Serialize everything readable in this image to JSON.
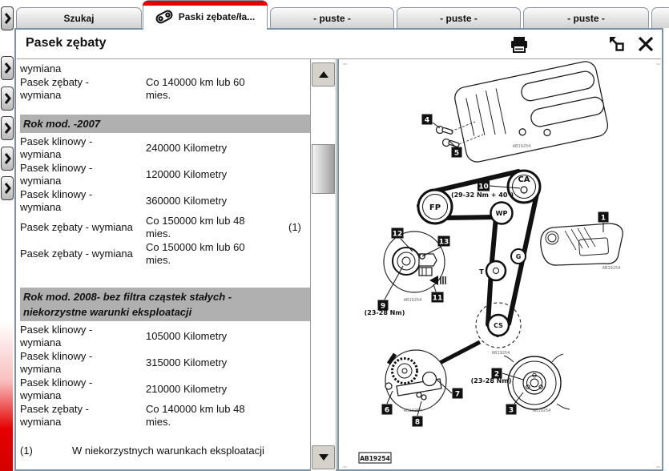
{
  "tabs": {
    "items": [
      {
        "label": "Szukaj"
      },
      {
        "label": "Paski zębate/ła..."
      },
      {
        "label": "- puste -"
      },
      {
        "label": "- puste -"
      },
      {
        "label": "- puste -"
      }
    ]
  },
  "panel": {
    "title": "Pasek zębaty"
  },
  "table": {
    "rows": [
      {
        "label": "wymiana",
        "value": "",
        "note": ""
      },
      {
        "label": "Pasek zębaty -\nwymiana",
        "value": "Co 140000 km lub 60\nmies.",
        "note": ""
      },
      {
        "label": "Pasek klinowy -\nwymiana",
        "value": "240000 Kilometry",
        "note": ""
      },
      {
        "label": "Pasek klinowy -\nwymiana",
        "value": "120000 Kilometry",
        "note": ""
      },
      {
        "label": "Pasek klinowy -\nwymiana",
        "value": "360000 Kilometry",
        "note": ""
      },
      {
        "label": "Pasek zębaty - wymiana",
        "value": "Co 150000 km lub 48\nmies.",
        "note": "(1)"
      },
      {
        "label": "Pasek zębaty - wymiana",
        "value": "Co 150000 km lub 60\nmies.",
        "note": ""
      },
      {
        "label": "Pasek klinowy -\nwymiana",
        "value": "105000 Kilometry",
        "note": ""
      },
      {
        "label": "Pasek klinowy -\nwymiana",
        "value": "315000 Kilometry",
        "note": ""
      },
      {
        "label": "Pasek klinowy -\nwymiana",
        "value": "210000 Kilometry",
        "note": ""
      },
      {
        "label": "Pasek zębaty -\nwymiana",
        "value": "Co 140000 km lub 48\nmies.",
        "note": ""
      }
    ],
    "sections": [
      {
        "title": "Rok mod. -2007"
      },
      {
        "title": "Rok mod. 2008- bez filtra cząstek stałych -\nniekorzystne warunki eksploatacji"
      }
    ],
    "footnote": {
      "num": "(1)",
      "text": "W niekorzystnych warunkach eksploatacji"
    }
  },
  "diagram": {
    "pulleys": {
      "fp": "FP",
      "ca": "CA",
      "wp": "WP",
      "g": "G",
      "t": "T",
      "cs": "CS"
    },
    "callouts": [
      "1",
      "2",
      "3",
      "4",
      "5",
      "6",
      "7",
      "8",
      "9",
      "10",
      "11",
      "12",
      "13"
    ],
    "torque_camshaft": "(29-32 Nm + 40°)",
    "torque_tensioner": "(23-28 Nm)",
    "torque_crankshaft": "(23-28 Nm)",
    "ref_code": "AB19254"
  },
  "colors": {
    "accent_red": "#e60000",
    "panel_border": "#7a93a8",
    "section_bg": "#b0b0b0"
  }
}
